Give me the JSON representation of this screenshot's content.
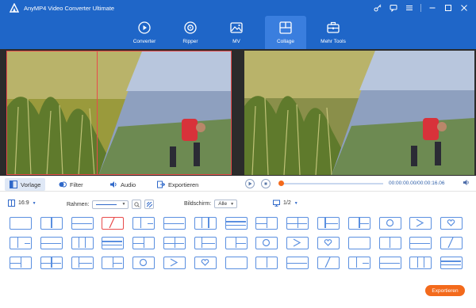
{
  "app": {
    "title": "AnyMP4 Video Converter Ultimate"
  },
  "nav": {
    "items": [
      {
        "label": "Converter",
        "icon": "converter-icon"
      },
      {
        "label": "Ripper",
        "icon": "disc-icon"
      },
      {
        "label": "MV",
        "icon": "mv-icon"
      },
      {
        "label": "Collage",
        "icon": "collage-icon",
        "active": true
      },
      {
        "label": "Mehr Tools",
        "icon": "toolbox-icon"
      }
    ]
  },
  "tabs": [
    {
      "label": "Vorlage",
      "icon": "template-icon",
      "active": true
    },
    {
      "label": "Filter",
      "icon": "filter-icon"
    },
    {
      "label": "Audio",
      "icon": "audio-icon"
    },
    {
      "label": "Exportieren",
      "icon": "export-icon"
    }
  ],
  "player": {
    "time": "00:00:00.00/00:00:16.06",
    "progress": 0
  },
  "options": {
    "ratio": "16:9",
    "rahmen_label": "Rahmen:",
    "bildschirm_label": "Bildschirm:",
    "bildschirm_value": "Alle",
    "page": "1/2"
  },
  "export_button": "Exportieren",
  "colors": {
    "header": "#1f66c8",
    "nav_active": "#3a7ede",
    "accent": "#f36a1c",
    "template_outline": "#5a8fe0",
    "selection": "#e84b4b"
  }
}
